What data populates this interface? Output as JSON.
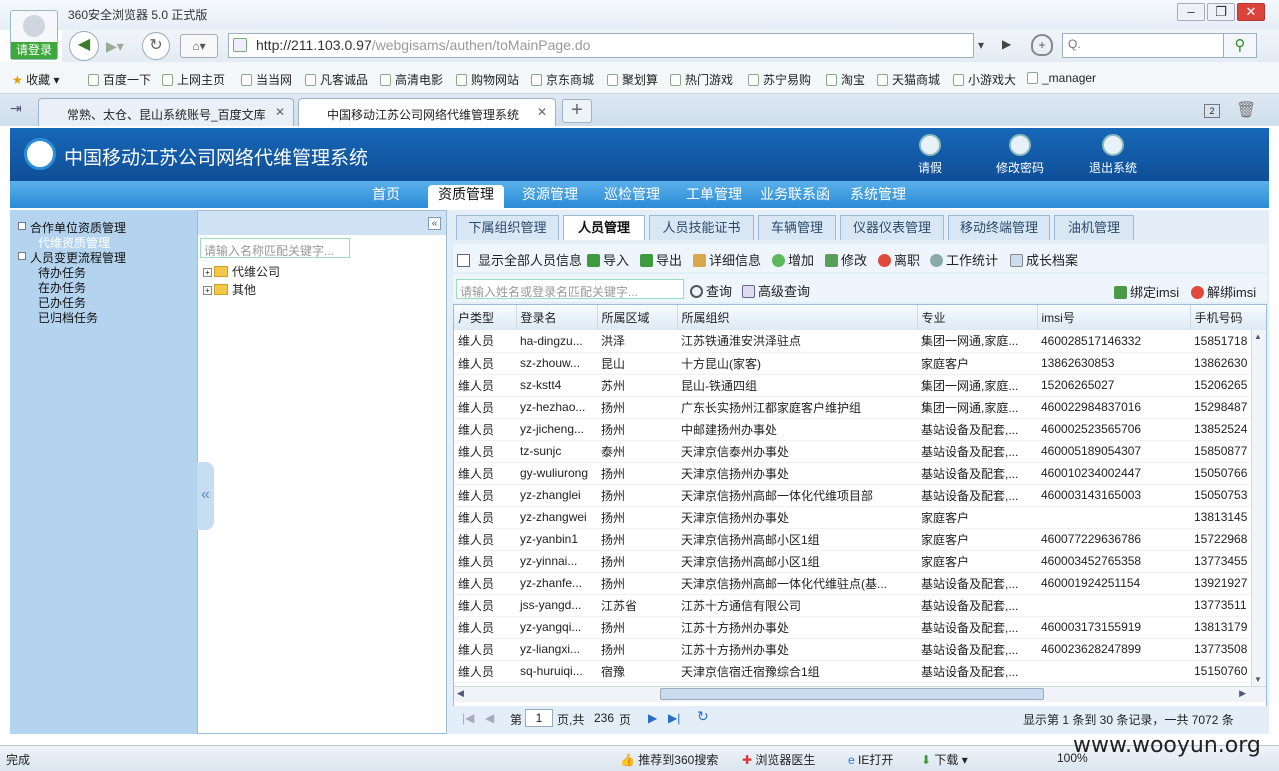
{
  "browser": {
    "title": "360安全浏览器 5.0 正式版",
    "login_label": "请登录",
    "url_host": "http://211.103.0.97",
    "url_path": "/webgisams/authen/toMainPage.do",
    "search_placeholder": "Q.",
    "favorites_label": "收藏",
    "favorites": [
      "百度一下",
      "上网主页",
      "当当网",
      "凡客诚品",
      "高清电影",
      "购物网站",
      "京东商城",
      "聚划算",
      "热门游戏",
      "苏宁易购",
      "淘宝",
      "天猫商城",
      "小游戏大",
      "_manager"
    ],
    "tabs": [
      {
        "label": "常熟、太仓、昆山系统账号_百度文库"
      },
      {
        "label": "中国移动江苏公司网络代维管理系统"
      }
    ],
    "tab_count": "2"
  },
  "app": {
    "title": "中国移动江苏公司网络代维管理系统",
    "header_buttons": [
      "请假",
      "修改密码",
      "退出系统"
    ],
    "menu": [
      "首页",
      "资质管理",
      "资源管理",
      "巡检管理",
      "工单管理",
      "业务联系函",
      "系统管理"
    ],
    "menu_active": "资质管理"
  },
  "left_tree": {
    "nodes": [
      {
        "label": "合作单位资质管理",
        "level": 0
      },
      {
        "label": "代维资质管理",
        "level": 1,
        "selected": true
      },
      {
        "label": "人员变更流程管理",
        "level": 0
      },
      {
        "label": "待办任务",
        "level": 1
      },
      {
        "label": "在办任务",
        "level": 1
      },
      {
        "label": "已办任务",
        "level": 1
      },
      {
        "label": "已归档任务",
        "level": 1
      }
    ]
  },
  "org_tree": {
    "search_placeholder": "请输入名称匹配关键字...",
    "nodes": [
      "代维公司",
      "其他"
    ]
  },
  "subtabs": [
    "下属组织管理",
    "人员管理",
    "人员技能证书",
    "车辆管理",
    "仪器仪表管理",
    "移动终端管理",
    "油机管理"
  ],
  "subtab_active": "人员管理",
  "toolbar": {
    "show_all": "显示全部人员信息",
    "import": "导入",
    "export": "导出",
    "detail": "详细信息",
    "add": "增加",
    "edit": "修改",
    "leave": "离职",
    "stats": "工作统计",
    "growth": "成长档案",
    "query_placeholder": "请输入姓名或登录名匹配关键字...",
    "query": "查询",
    "advanced_query": "高级查询",
    "bind_imsi": "绑定imsi",
    "unbind_imsi": "解绑imsi"
  },
  "table": {
    "columns": [
      "户类型",
      "登录名",
      "所属区域",
      "所属组织",
      "专业",
      "imsi号",
      "手机号码"
    ],
    "rows": [
      [
        "维人员",
        "ha-dingzu...",
        "洪泽",
        "江苏铁通淮安洪泽驻点",
        "集团一网通,家庭...",
        "460028517146332",
        "15851718"
      ],
      [
        "维人员",
        "sz-zhouw...",
        "昆山",
        "十方昆山(家客)",
        "家庭客户",
        "13862630853",
        "13862630"
      ],
      [
        "维人员",
        "sz-kstt4",
        "苏州",
        "昆山-铁通四组",
        "集团一网通,家庭...",
        "15206265027",
        "15206265"
      ],
      [
        "维人员",
        "yz-hezhao...",
        "扬州",
        "广东长实扬州江都家庭客户维护组",
        "集团一网通,家庭...",
        "460022984837016",
        "15298487"
      ],
      [
        "维人员",
        "yz-jicheng...",
        "扬州",
        "中邮建扬州办事处",
        "基站设备及配套,...",
        "460002523565706",
        "13852524"
      ],
      [
        "维人员",
        "tz-sunjc",
        "泰州",
        "天津京信泰州办事处",
        "基站设备及配套,...",
        "460005189054307",
        "15850877"
      ],
      [
        "维人员",
        "gy-wuliurong",
        "扬州",
        "天津京信扬州办事处",
        "基站设备及配套,...",
        "460010234002447",
        "15050766"
      ],
      [
        "维人员",
        "yz-zhanglei",
        "扬州",
        "天津京信扬州高邮一体化代维项目部",
        "基站设备及配套,...",
        "460003143165003",
        "15050753"
      ],
      [
        "维人员",
        "yz-zhangwei",
        "扬州",
        "天津京信扬州办事处",
        "家庭客户",
        "",
        "13813145"
      ],
      [
        "维人员",
        "yz-yanbin1",
        "扬州",
        "天津京信扬州高邮小区1组",
        "家庭客户",
        "460077229636786",
        "15722968"
      ],
      [
        "维人员",
        "yz-yinnai...",
        "扬州",
        "天津京信扬州高邮小区1组",
        "家庭客户",
        "460003452765358",
        "13773455"
      ],
      [
        "维人员",
        "yz-zhanfe...",
        "扬州",
        "天津京信扬州高邮一体化代维驻点(基...",
        "基站设备及配套,...",
        "460001924251154",
        "13921927"
      ],
      [
        "维人员",
        "jss-yangd...",
        "江苏省",
        "江苏十方通信有限公司",
        "基站设备及配套,...",
        "",
        "13773511"
      ],
      [
        "维人员",
        "yz-yangqi...",
        "扬州",
        "江苏十方扬州办事处",
        "基站设备及配套,...",
        "460003173155919",
        "13813179"
      ],
      [
        "维人员",
        "yz-liangxi...",
        "扬州",
        "江苏十方扬州办事处",
        "基站设备及配套,...",
        "460023628247899",
        "13773508"
      ],
      [
        "维人员",
        "sq-huruiqi...",
        "宿豫",
        "天津京信宿迁宿豫综合1组",
        "基站设备及配套,...",
        "",
        "15150760"
      ]
    ]
  },
  "pager": {
    "page_label": "第",
    "page": "1",
    "of_label": "页,共",
    "total_pages": "236",
    "pages_suffix": "页",
    "summary": "显示第  1 条到  30 条记录，一共  7072 条"
  },
  "statusbar": {
    "status": "完成",
    "recommend": "推荐到360搜索",
    "doctor": "浏览器医生",
    "ie_open": "IE打开",
    "download": "下载",
    "zoom": "100%"
  },
  "watermark": "www.wooyun.org"
}
